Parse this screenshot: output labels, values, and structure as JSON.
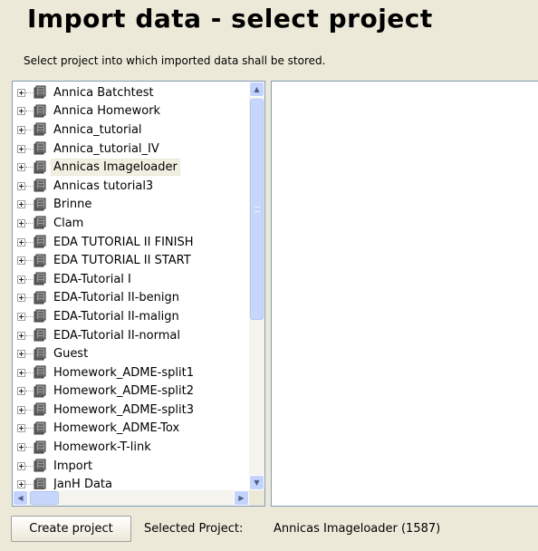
{
  "header": {
    "title": "Import data - select project",
    "subtitle": "Select project into which imported data shall be stored."
  },
  "tree": {
    "icon": "database-icon",
    "selected_index": 4,
    "items": [
      {
        "label": "Annica Batchtest"
      },
      {
        "label": "Annica Homework"
      },
      {
        "label": "Annica_tutorial"
      },
      {
        "label": "Annica_tutorial_IV"
      },
      {
        "label": "Annicas Imageloader"
      },
      {
        "label": "Annicas tutorial3"
      },
      {
        "label": "Brinne"
      },
      {
        "label": "Clam"
      },
      {
        "label": "EDA TUTORIAL II FINISH"
      },
      {
        "label": "EDA TUTORIAL II START"
      },
      {
        "label": "EDA-Tutorial I"
      },
      {
        "label": "EDA-Tutorial II-benign"
      },
      {
        "label": "EDA-Tutorial II-malign"
      },
      {
        "label": "EDA-Tutorial II-normal"
      },
      {
        "label": "Guest"
      },
      {
        "label": "Homework_ADME-split1"
      },
      {
        "label": "Homework_ADME-split2"
      },
      {
        "label": "Homework_ADME-split3"
      },
      {
        "label": "Homework_ADME-Tox"
      },
      {
        "label": "Homework-T-link"
      },
      {
        "label": "Import"
      },
      {
        "label": "JanH Data"
      }
    ]
  },
  "footer": {
    "create_button": "Create project",
    "selected_label": "Selected Project:",
    "selected_value": "Annicas Imageloader (1587)"
  },
  "colors": {
    "background": "#ece9d8",
    "panel_border": "#7f9db9",
    "scrollbar": "#c3d3fd"
  }
}
